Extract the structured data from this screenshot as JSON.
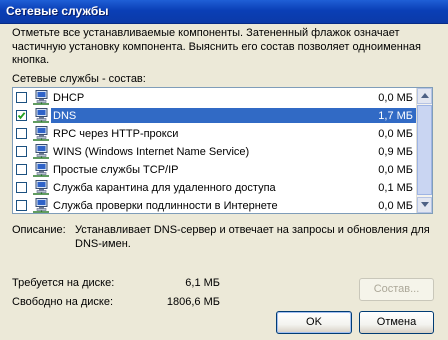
{
  "window": {
    "title": "Сетевые службы"
  },
  "description": "Отметьте все устанавливаемые компоненты. Затененный флажок означает частичную установку компонента. Выяснить его состав позволяет одноименная кнопка.",
  "list_label": "Сетевые службы - состав:",
  "components": [
    {
      "name": "DHCP",
      "size": "0,0 МБ",
      "checked": false,
      "selected": false,
      "icon": "network-computer-icon"
    },
    {
      "name": "DNS",
      "size": "1,7 МБ",
      "checked": true,
      "selected": true,
      "icon": "network-computer-icon"
    },
    {
      "name": "RPC через HTTP-прокси",
      "size": "0,0 МБ",
      "checked": false,
      "selected": false,
      "icon": "network-computer-icon"
    },
    {
      "name": "WINS (Windows Internet Name Service)",
      "size": "0,9 МБ",
      "checked": false,
      "selected": false,
      "icon": "network-computer-icon"
    },
    {
      "name": "Простые службы TCP/IP",
      "size": "0,0 МБ",
      "checked": false,
      "selected": false,
      "icon": "network-computer-icon"
    },
    {
      "name": "Служба карантина для удаленного доступа",
      "size": "0,1 МБ",
      "checked": false,
      "selected": false,
      "icon": "network-computer-icon"
    },
    {
      "name": "Служба проверки подлинности в Интернете",
      "size": "0,0 МБ",
      "checked": false,
      "selected": false,
      "icon": "network-computer-icon"
    }
  ],
  "info": {
    "label": "Описание:",
    "text": "Устанавливает DNS-сервер и отвечает на запросы и обновления для DNS-имен."
  },
  "disk": {
    "required_label": "Требуется на диске:",
    "required_value": "6,1 МБ",
    "free_label": "Свободно на диске:",
    "free_value": "1806,6 МБ"
  },
  "buttons": {
    "details": "Состав...",
    "ok": "OK",
    "cancel": "Отмена"
  },
  "colors": {
    "title_bar": "#0a3fb6",
    "selection": "#316ac5",
    "face": "#ece9d8"
  }
}
